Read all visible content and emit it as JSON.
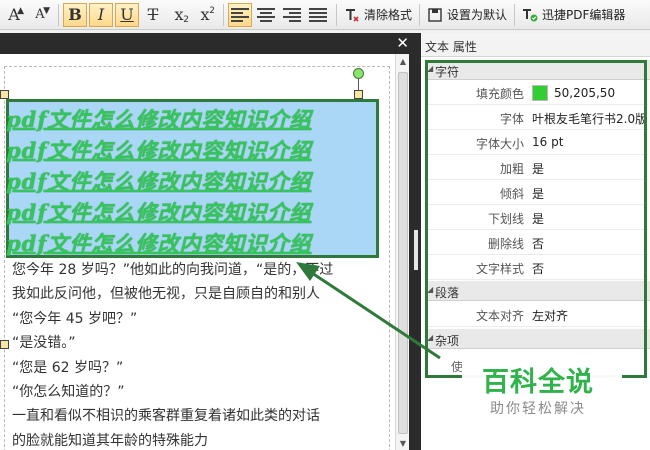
{
  "toolbar": {
    "buttons": [
      {
        "name": "increase-font-size-icon",
        "glyph": "A",
        "mark": "▲"
      },
      {
        "name": "decrease-font-size-icon",
        "glyph": "A",
        "mark": "▼"
      },
      {
        "name": "bold-icon",
        "glyph": "B"
      },
      {
        "name": "italic-icon",
        "glyph": "I"
      },
      {
        "name": "underline-icon",
        "glyph": "U"
      },
      {
        "name": "strikethrough-icon",
        "glyph": "T"
      },
      {
        "name": "subscript-icon",
        "glyph": "x",
        "mark": "2"
      },
      {
        "name": "superscript-icon",
        "glyph": "x",
        "mark": "2"
      }
    ],
    "clear_format_label": "清除格式",
    "set_default_label": "设置为默认",
    "editor_label": "迅捷PDF编辑器"
  },
  "document": {
    "close_glyph": "✕",
    "calligraphy_lines": [
      "pdf文件怎么修改内容知识介绍",
      "pdf文件怎么修改内容知识介绍",
      "pdf文件怎么修改内容知识介绍",
      "pdf文件怎么修改内容知识介绍",
      "pdf文件怎么修改内容知识介绍"
    ],
    "body_lines": [
      "您今年 28 岁吗？”他如此的向我问道，“是的，不过",
      "我如此反问他，但被他无视，只是自顾自的和别人",
      "“您今年 45 岁吧？”",
      "“是没错。”",
      "“您是 62 岁吗？”",
      "“你怎么知道的？”",
      "一直和看似不相识的乘客群重复着诸如此类的对话",
      "的脸就能知道其年龄的特殊能力"
    ]
  },
  "properties": {
    "header": "文本 属性",
    "groups": [
      "字符",
      "段落",
      "杂项"
    ],
    "character_rows": [
      {
        "name": "填充颜色",
        "value": "50,205,50",
        "swatch": "#32cd32"
      },
      {
        "name": "字体",
        "value": "叶根友毛笔行书2.0版"
      },
      {
        "name": "字体大小",
        "value": "16 pt"
      },
      {
        "name": "加粗",
        "value": "是"
      },
      {
        "name": "倾斜",
        "value": "是"
      },
      {
        "name": "下划线",
        "value": "是"
      },
      {
        "name": "删除线",
        "value": "否"
      },
      {
        "name": "文字样式",
        "value": "否"
      }
    ],
    "paragraph_rows": [
      {
        "name": "文本对齐",
        "value": "左对齐"
      }
    ],
    "misc_clipped": "使"
  },
  "watermark": {
    "title": "百科全说",
    "subtitle": "助你轻松解决"
  },
  "colors": {
    "highlight": "#2f7a3a",
    "selection": "#a9d7f5",
    "calligraphy": "#35c55a"
  }
}
